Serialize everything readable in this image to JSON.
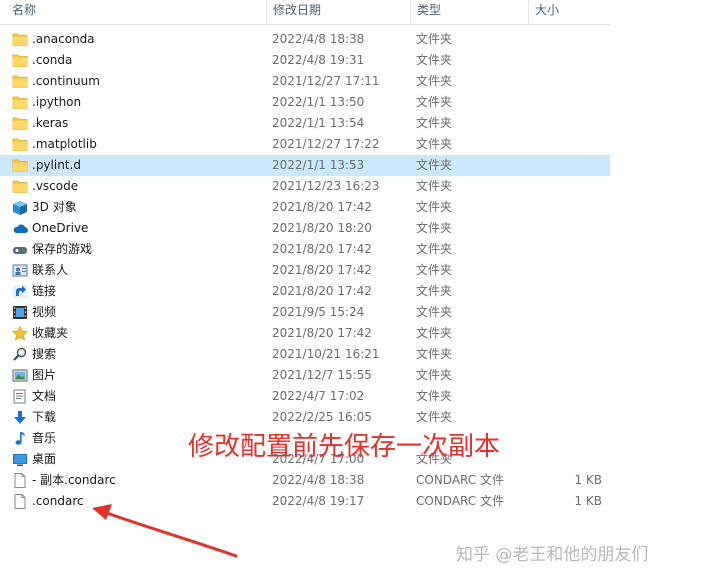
{
  "columns": {
    "name": "名称",
    "date": "修改日期",
    "type": "类型",
    "size": "大小"
  },
  "rows": [
    {
      "name": ".anaconda",
      "date": "2022/4/8 18:38",
      "type": "文件夹",
      "size": "",
      "icon": "folder-icon"
    },
    {
      "name": ".conda",
      "date": "2022/4/8 19:31",
      "type": "文件夹",
      "size": "",
      "icon": "folder-icon"
    },
    {
      "name": ".continuum",
      "date": "2021/12/27 17:11",
      "type": "文件夹",
      "size": "",
      "icon": "folder-icon"
    },
    {
      "name": ".ipython",
      "date": "2022/1/1 13:50",
      "type": "文件夹",
      "size": "",
      "icon": "folder-icon"
    },
    {
      "name": ".keras",
      "date": "2022/1/1 13:54",
      "type": "文件夹",
      "size": "",
      "icon": "folder-icon"
    },
    {
      "name": ".matplotlib",
      "date": "2021/12/27 17:22",
      "type": "文件夹",
      "size": "",
      "icon": "folder-icon"
    },
    {
      "name": ".pylint.d",
      "date": "2022/1/1 13:53",
      "type": "文件夹",
      "size": "",
      "icon": "folder-icon",
      "selected": true
    },
    {
      "name": ".vscode",
      "date": "2021/12/23 16:23",
      "type": "文件夹",
      "size": "",
      "icon": "folder-icon"
    },
    {
      "name": "3D 对象",
      "date": "2021/8/20 17:42",
      "type": "文件夹",
      "size": "",
      "icon": "3d-objects-icon"
    },
    {
      "name": "OneDrive",
      "date": "2021/8/20 18:20",
      "type": "文件夹",
      "size": "",
      "icon": "onedrive-cloud-icon"
    },
    {
      "name": "保存的游戏",
      "date": "2021/8/20 17:42",
      "type": "文件夹",
      "size": "",
      "icon": "saved-games-icon"
    },
    {
      "name": "联系人",
      "date": "2021/8/20 17:42",
      "type": "文件夹",
      "size": "",
      "icon": "contacts-icon"
    },
    {
      "name": "链接",
      "date": "2021/8/20 17:42",
      "type": "文件夹",
      "size": "",
      "icon": "links-arrow-icon"
    },
    {
      "name": "视频",
      "date": "2021/9/5 15:24",
      "type": "文件夹",
      "size": "",
      "icon": "video-film-icon"
    },
    {
      "name": "收藏夹",
      "date": "2021/8/20 17:42",
      "type": "文件夹",
      "size": "",
      "icon": "favorites-star-icon"
    },
    {
      "name": "搜索",
      "date": "2021/10/21 16:21",
      "type": "文件夹",
      "size": "",
      "icon": "search-magnifier-icon"
    },
    {
      "name": "图片",
      "date": "2021/12/7 15:55",
      "type": "文件夹",
      "size": "",
      "icon": "pictures-icon"
    },
    {
      "name": "文档",
      "date": "2022/4/7 17:02",
      "type": "文件夹",
      "size": "",
      "icon": "documents-icon"
    },
    {
      "name": "下载",
      "date": "2022/2/25 16:05",
      "type": "文件夹",
      "size": "",
      "icon": "downloads-arrow-icon"
    },
    {
      "name": "音乐",
      "date": "",
      "type": "",
      "size": "",
      "icon": "music-note-icon"
    },
    {
      "name": "桌面",
      "date": "2022/4/7 17:00",
      "type": "文件夹",
      "size": "",
      "icon": "desktop-icon"
    },
    {
      "name": " - 副本.condarc",
      "date": "2022/4/8 18:38",
      "type": "CONDARC 文件",
      "size": "1 KB",
      "icon": "file-icon"
    },
    {
      "name": ".condarc",
      "date": "2022/4/8 19:17",
      "type": "CONDARC 文件",
      "size": "1 KB",
      "icon": "file-icon"
    }
  ],
  "annotation": "修改配置前先保存一次副本",
  "watermark": "知乎 @老王和他的朋友们",
  "colors": {
    "selection": "#cce8ff",
    "annotation_red": "#e0332b",
    "folder_yellow": "#f7c94b"
  }
}
